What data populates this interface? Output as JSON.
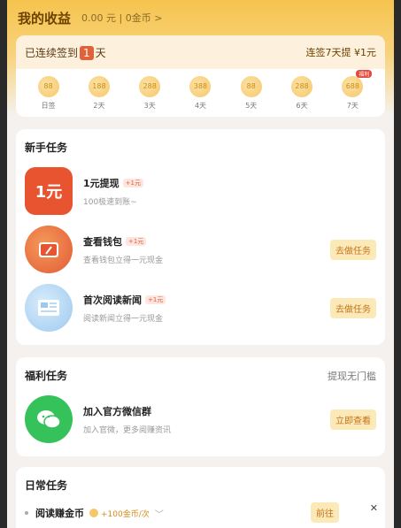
{
  "header": {
    "title": "我的收益",
    "balance": "0.00 元 | 0金币 >"
  },
  "checkin": {
    "streak_prefix": "已连续签到",
    "streak_num": "1",
    "streak_suffix": "天",
    "bonus": "连签7天提 ¥1元",
    "days": [
      {
        "coins": "88",
        "label": "日签"
      },
      {
        "coins": "188",
        "label": "2天"
      },
      {
        "coins": "288",
        "label": "3天"
      },
      {
        "coins": "388",
        "label": "4天"
      },
      {
        "coins": "88",
        "label": "5天"
      },
      {
        "coins": "288",
        "label": "6天"
      },
      {
        "coins": "688",
        "label": "7天",
        "tag": "福利"
      }
    ]
  },
  "novice": {
    "title": "新手任务",
    "tasks": [
      {
        "name": "1元提现",
        "plus": "+1元",
        "desc": "100极速到账~",
        "button": "",
        "icon_text": "1元"
      },
      {
        "name": "查看钱包",
        "plus": "+1元",
        "desc": "查看钱包立得一元现金",
        "button": "去做任务",
        "icon_text": ""
      },
      {
        "name": "首次阅读新闻",
        "plus": "+1元",
        "desc": "阅读新闻立得一元现金",
        "button": "去做任务",
        "icon_text": ""
      }
    ]
  },
  "welfare": {
    "title": "福利任务",
    "hint": "提现无门槛",
    "task": {
      "name": "加入官方微信群",
      "desc": "加入官微，更多阅赚资讯",
      "button": "立即查看"
    }
  },
  "daily": {
    "title": "日常任务",
    "row": {
      "name": "阅读赚金币",
      "reward": "+100金币/次",
      "button": "前往"
    }
  },
  "colors": {
    "brand": "#f6c44e",
    "accent": "#e0623a",
    "button_bg": "#fbe9b8"
  }
}
